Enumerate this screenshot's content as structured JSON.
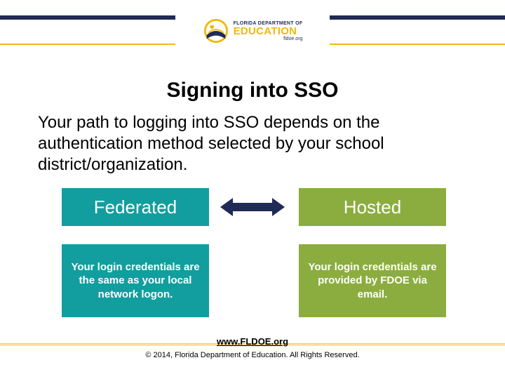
{
  "logo": {
    "small": "FLORIDA DEPARTMENT OF",
    "big": "EDUCATION",
    "url": "fldoe.org"
  },
  "title": "Signing into SSO",
  "intro": "Your path to logging into SSO depends on the authentication method selected by your school district/organization.",
  "federated": {
    "heading": "Federated",
    "body": "Your login credentials are the same as your local network logon."
  },
  "hosted": {
    "heading": "Hosted",
    "body": "Your login credentials are provided by   FDOE via email."
  },
  "footer": {
    "link": "www.FLDOE.org",
    "copy": "© 2014, Florida Department of Education. All Rights Reserved."
  },
  "colors": {
    "navy": "#1f2a56",
    "gold": "#f0b90b",
    "teal": "#129e9e",
    "olive": "#8bad3f"
  }
}
